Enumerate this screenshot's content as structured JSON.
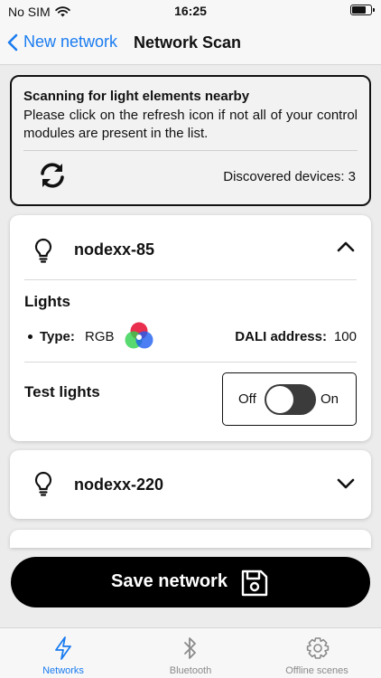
{
  "status_bar": {
    "carrier": "No SIM",
    "time": "16:25",
    "battery_level": 0.8
  },
  "nav": {
    "back_label": "New network",
    "title": "Network Scan"
  },
  "scan_info": {
    "title": "Scanning for light elements nearby",
    "text": "Please click on the refresh icon if not all of your control modules are present in the list.",
    "discovered": "Discovered devices: 3"
  },
  "devices": [
    {
      "name": "nodexx-85",
      "expanded": true,
      "lights_title": "Lights",
      "type_label": "Type:",
      "type_value": "RGB",
      "dali_label": "DALI address:",
      "dali_value": "100",
      "test_label": "Test lights",
      "toggle_off": "Off",
      "toggle_on": "On",
      "toggle_state": false
    },
    {
      "name": "nodexx-220",
      "expanded": false
    }
  ],
  "save_button": {
    "label": "Save network"
  },
  "tabs": [
    {
      "label": "Networks",
      "icon": "lightning-icon",
      "active": true
    },
    {
      "label": "Bluetooth",
      "icon": "bluetooth-icon",
      "active": false
    },
    {
      "label": "Offline scenes",
      "icon": "gear-icon",
      "active": false
    }
  ],
  "colors": {
    "accent": "#1a7cf0",
    "button": "#000000",
    "switch_track": "#3b3b3b"
  }
}
